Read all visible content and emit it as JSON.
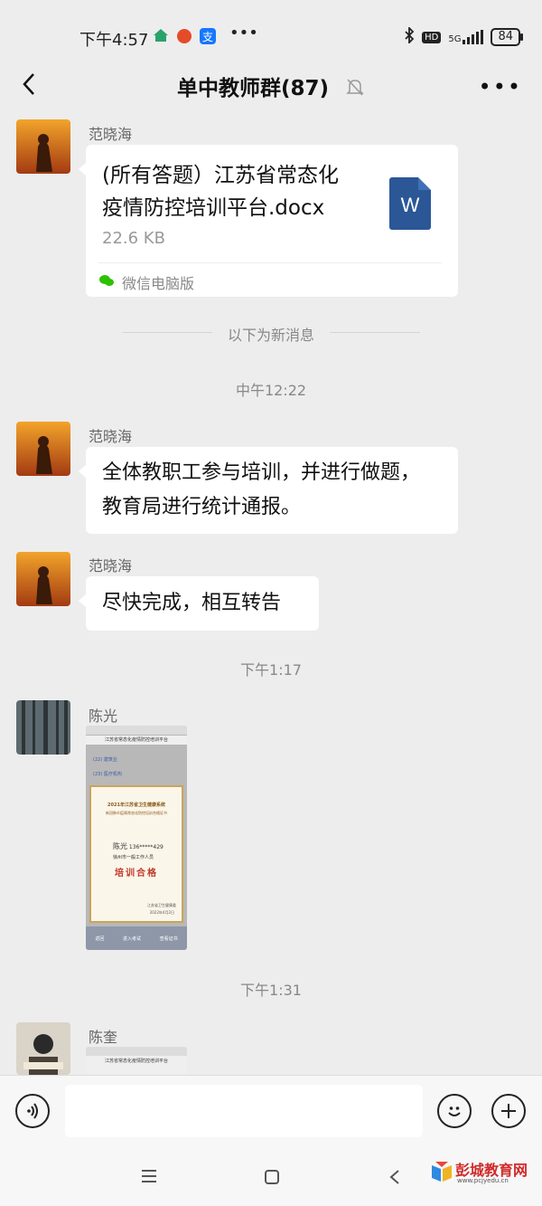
{
  "status_bar": {
    "time": "下午4:57",
    "network": "5G",
    "hd": "HD",
    "battery": "84",
    "icons": [
      "home-app-icon",
      "red-app-icon",
      "alipay-icon",
      "bluetooth-icon"
    ]
  },
  "header": {
    "title": "单中教师群(87)",
    "more": "•••"
  },
  "messages": {
    "m1": {
      "sender": "范晓海",
      "file_name_line1": "(所有答题）江苏省常态化",
      "file_name_line2": "疫情防控培训平台.docx",
      "file_size": "22.6 KB",
      "file_icon_letter": "W",
      "source": "微信电脑版"
    },
    "new_divider": "以下为新消息",
    "time1": "中午12:22",
    "m2": {
      "sender": "范晓海",
      "line1": "全体教职工参与培训，并进行做题，",
      "line2": "教育局进行统计通报。"
    },
    "m3": {
      "sender": "范晓海",
      "text": "尽快完成，相互转告"
    },
    "time2": "下午1:17",
    "m4": {
      "sender": "陈光",
      "shot_header": "江苏省常态化疫情防控培训平台",
      "cert_title1": "2021年江苏省卫生健康系统",
      "cert_title2": "新冠肺炎疫情常态化防控培训合格证书",
      "cert_name": "陈光",
      "cert_phone": "136*****429",
      "cert_unit": "徐州市一般工作人员",
      "cert_result": "培训合格",
      "cert_issuer": "江苏省卫生健康委",
      "cert_date": "2022年4月2日",
      "row1": "(22) 建筑业",
      "row2": "(23) 医疗机构",
      "btn_back": "返回",
      "btn_exam": "进入考试",
      "btn_cert": "查看证书"
    },
    "time3": "下午1:31",
    "m5": {
      "sender": "陈奎",
      "shot_header": "江苏省常态化疫情防控培训平台"
    }
  },
  "watermark": {
    "name": "彭城教育网",
    "url": "www.pcjyedu.cn"
  },
  "colors": {
    "background": "#ededed",
    "bubble": "#ffffff",
    "word_blue": "#2b5797",
    "cert_red": "#c0392b"
  }
}
